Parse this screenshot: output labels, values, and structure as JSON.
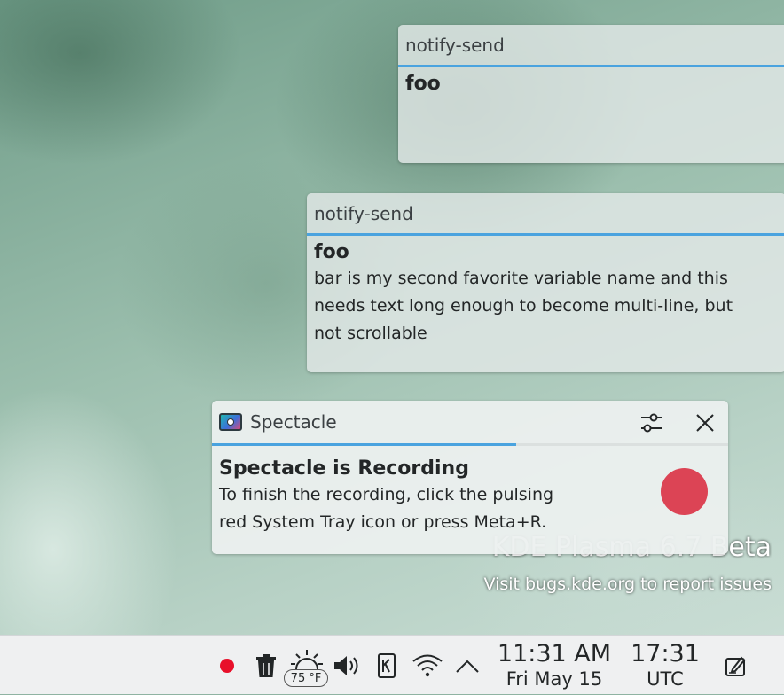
{
  "desktop": {
    "watermark_title": "KDE Plasma 6.7 Beta",
    "watermark_subtitle": "Visit bugs.kde.org to report issues"
  },
  "notifications": [
    {
      "app": "notify-send",
      "summary": "foo",
      "body": ""
    },
    {
      "app": "notify-send",
      "summary": "foo",
      "body_lines": [
        "bar is my second favorite variable name and this",
        "needs text long enough to become multi-line, but",
        "not scrollable"
      ]
    }
  ],
  "spectacle": {
    "app": "Spectacle",
    "summary": "Spectacle is Recording",
    "body_lines": [
      "To finish the recording, click the pulsing",
      "red System Tray icon or press Meta+R."
    ],
    "progress_fraction": 0.59,
    "record_color": "#dc4455",
    "accent": "#4aa3df"
  },
  "panel": {
    "tray_icons": [
      "record-icon",
      "trash-icon",
      "weather-icon",
      "volume-icon",
      "kdeconnect-icon",
      "wifi-icon",
      "chevron-up-icon"
    ],
    "weather_temp": "75 °F",
    "clock_local_time": "11:31 AM",
    "clock_local_date": "Fri May 15",
    "clock_utc_time": "17:31",
    "clock_utc_zone": "UTC"
  }
}
